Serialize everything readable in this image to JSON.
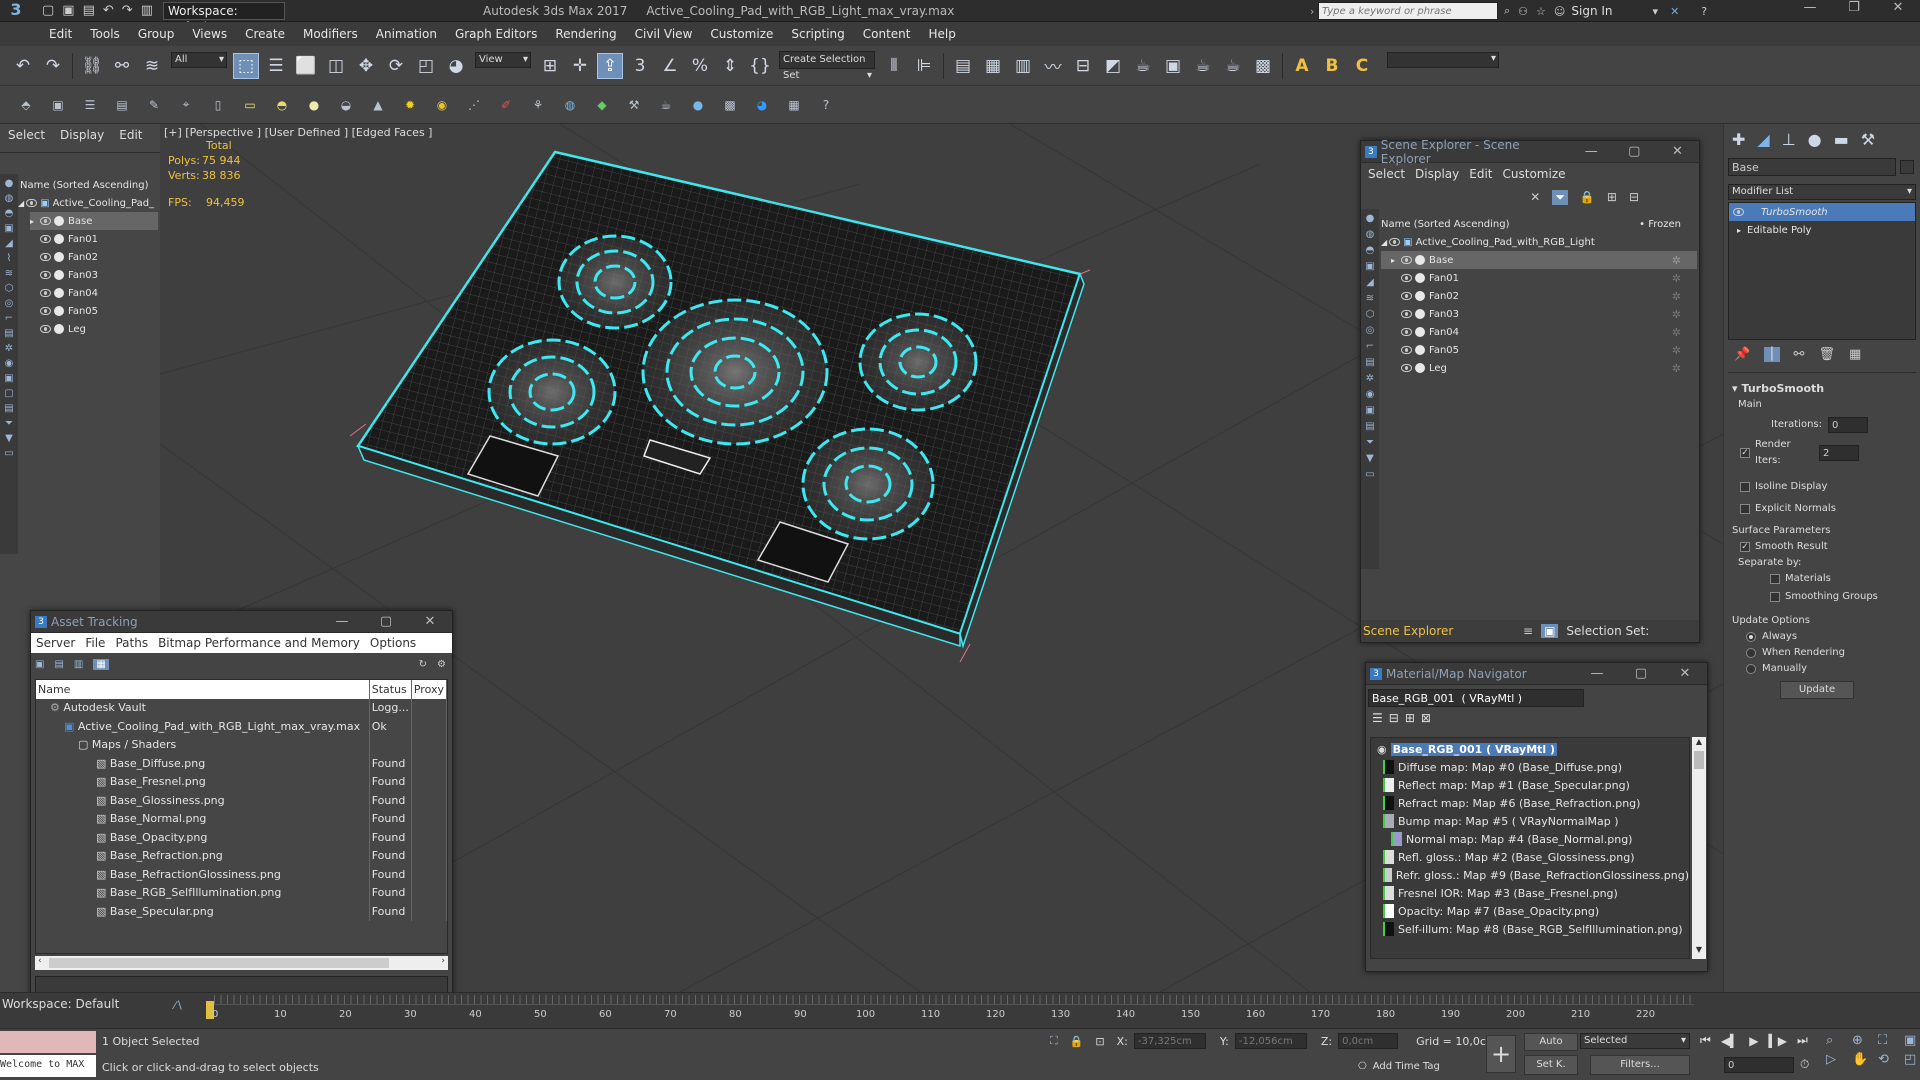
{
  "titlebar": {
    "workspace_label": "Workspace: Default",
    "title": "Autodesk 3ds Max 2017     Active_Cooling_Pad_with_RGB_Light_max_vray.max",
    "search_placeholder": "Type a keyword or phrase",
    "sign_in": "Sign In"
  },
  "menu": [
    "Edit",
    "Tools",
    "Group",
    "Views",
    "Create",
    "Modifiers",
    "Animation",
    "Graph Editors",
    "Rendering",
    "Civil View",
    "Customize",
    "Scripting",
    "Content",
    "Help"
  ],
  "toolbar": {
    "filter_value": "All",
    "ref_coord": "View",
    "selection_set": "Create Selection Set"
  },
  "left_explorer": {
    "menu": [
      "Select",
      "Display",
      "Edit"
    ],
    "header": "Name (Sorted Ascending)",
    "root": "Active_Cooling_Pad_",
    "items": [
      "Base",
      "Fan01",
      "Fan02",
      "Fan03",
      "Fan04",
      "Fan05",
      "Leg"
    ]
  },
  "viewport": {
    "label": "[+] [Perspective ] [User Defined ] [Edged Faces ]",
    "stats_total": "Total",
    "polys_label": "Polys:",
    "polys_value": "75 944",
    "verts_label": "Verts:",
    "verts_value": "38 836",
    "fps_label": "FPS:",
    "fps_value": "94,459",
    "wire_color": "#3ee8f0"
  },
  "scene_explorer": {
    "title": "Scene Explorer - Scene Explorer",
    "menu": [
      "Select",
      "Display",
      "Edit",
      "Customize"
    ],
    "header": "Name (Sorted Ascending)",
    "frozen": "• Frozen",
    "root": "Active_Cooling_Pad_with_RGB_Light",
    "items": [
      "Base",
      "Fan01",
      "Fan02",
      "Fan03",
      "Fan04",
      "Fan05",
      "Leg"
    ],
    "footer_name": "Scene Explorer",
    "selection_set_label": "Selection Set:"
  },
  "asset_tracking": {
    "title": "Asset Tracking",
    "menu": [
      "Server",
      "File",
      "Paths",
      "Bitmap Performance and Memory",
      "Options"
    ],
    "columns": [
      "Name",
      "Status",
      "Proxy"
    ],
    "rows": [
      {
        "name": "Autodesk Vault",
        "status": "Logg..."
      },
      {
        "name": "Active_Cooling_Pad_with_RGB_Light_max_vray.max",
        "status": "Ok"
      },
      {
        "name": "Maps / Shaders",
        "status": ""
      },
      {
        "name": "Base_Diffuse.png",
        "status": "Found"
      },
      {
        "name": "Base_Fresnel.png",
        "status": "Found"
      },
      {
        "name": "Base_Glossiness.png",
        "status": "Found"
      },
      {
        "name": "Base_Normal.png",
        "status": "Found"
      },
      {
        "name": "Base_Opacity.png",
        "status": "Found"
      },
      {
        "name": "Base_Refraction.png",
        "status": "Found"
      },
      {
        "name": "Base_RefractionGlossiness.png",
        "status": "Found"
      },
      {
        "name": "Base_RGB_SelfIllumination.png",
        "status": "Found"
      },
      {
        "name": "Base_Specular.png",
        "status": "Found"
      }
    ]
  },
  "material_nav": {
    "title": "Material/Map Navigator",
    "field": "Base_RGB_001  ( VRayMtl )",
    "root": "Base_RGB_001  ( VRayMtl )",
    "items": [
      "Diffuse map: Map #0 (Base_Diffuse.png)",
      "Reflect map: Map #1 (Base_Specular.png)",
      "Refract map: Map #6 (Base_Refraction.png)",
      "Bump map: Map #5  ( VRayNormalMap )",
      "Normal map: Map #4 (Base_Normal.png)",
      "Refl. gloss.: Map #2 (Base_Glossiness.png)",
      "Refr. gloss.: Map #9 (Base_RefractionGlossiness.png)",
      "Fresnel IOR: Map #3 (Base_Fresnel.png)",
      "Opacity: Map #7 (Base_Opacity.png)",
      "Self-illum: Map #8 (Base_RGB_SelfIllumination.png)"
    ]
  },
  "command_panel": {
    "object_name": "Base",
    "modifier_list": "Modifier List",
    "stack": [
      "TurboSmooth",
      "Editable Poly"
    ],
    "rollout": "TurboSmooth",
    "main": "Main",
    "iterations_label": "Iterations:",
    "iterations_value": "0",
    "render_iters_label": "Render Iters:",
    "render_iters_value": "2",
    "isoline": "Isoline Display",
    "explicit": "Explicit Normals",
    "surface": "Surface Parameters",
    "smooth_result": "Smooth Result",
    "separate_by": "Separate by:",
    "materials": "Materials",
    "smoothing_groups": "Smoothing Groups",
    "update_options": "Update Options",
    "always": "Always",
    "when_rendering": "When Rendering",
    "manually": "Manually",
    "update": "Update"
  },
  "timeline": {
    "workspace": "Workspace: Default",
    "ticks": [
      "0",
      "10",
      "20",
      "30",
      "40",
      "50",
      "60",
      "70",
      "80",
      "90",
      "100",
      "110",
      "120",
      "130",
      "140",
      "150",
      "160",
      "170",
      "180",
      "190",
      "200",
      "210",
      "220"
    ]
  },
  "status": {
    "maxscript": "Welcome to MAX",
    "selected": "1 Object Selected",
    "prompt": "Click or click-and-drag to select objects",
    "x_label": "X:",
    "x_value": "-37,325cm",
    "y_label": "Y:",
    "y_value": "-12,056cm",
    "z_label": "Z:",
    "z_value": "0,0cm",
    "grid": "Grid = 10,0cm",
    "add_time_tag": "Add Time Tag",
    "auto": "Auto",
    "set_key": "Set K.",
    "selected_dd": "Selected",
    "filters": "Filters...",
    "frame": "0"
  }
}
